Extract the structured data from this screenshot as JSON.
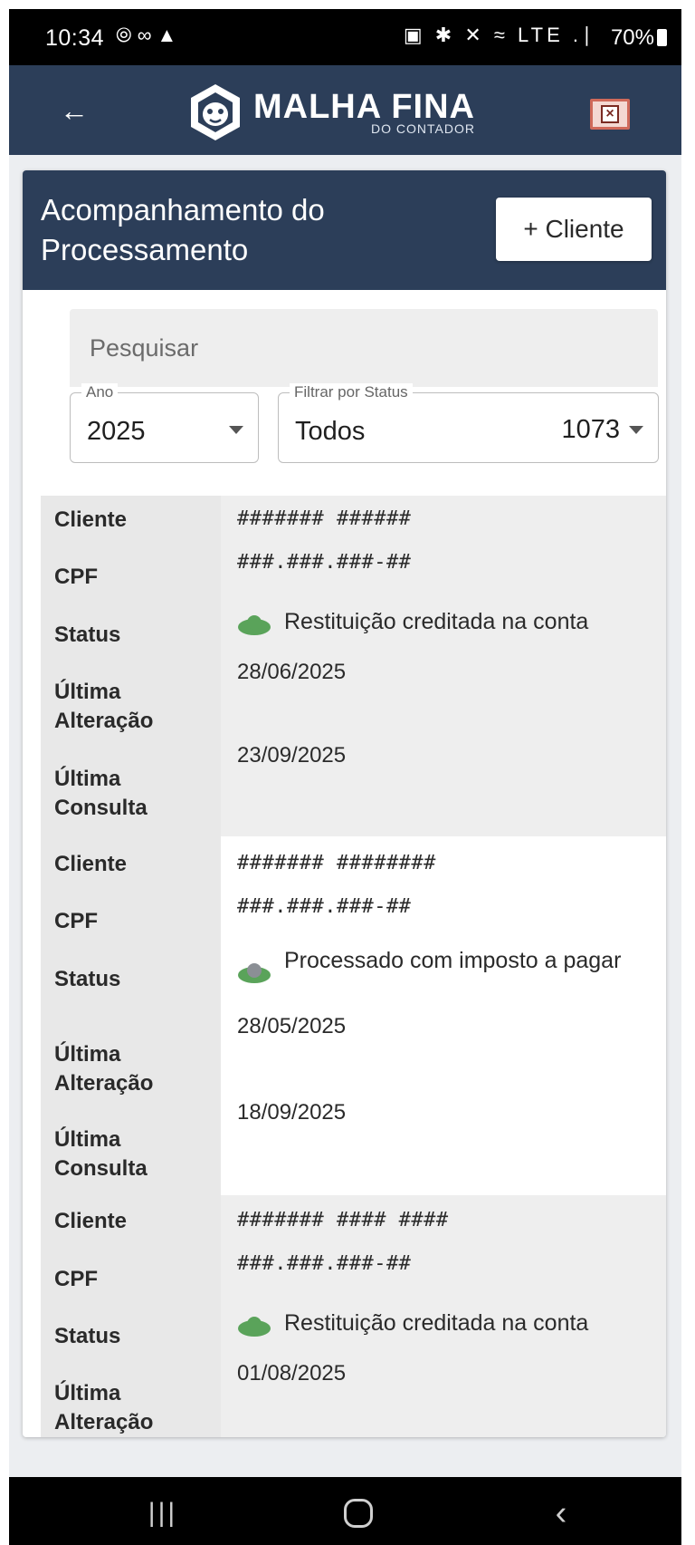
{
  "status_bar": {
    "time": "10:34",
    "left_icons": "⦾ ∞ ▲",
    "right_icons": "▣ ✱ ✕ ≈ LTE .∣",
    "battery": "70%"
  },
  "app_bar": {
    "logo_main": "MALHA FINA",
    "logo_sub": "DO CONTADOR"
  },
  "card": {
    "title": "Acompanhamento do Processamento",
    "add_button": "+ Cliente"
  },
  "search": {
    "placeholder": "Pesquisar"
  },
  "filters": {
    "year_label": "Ano",
    "year_value": "2025",
    "status_label": "Filtrar por Status",
    "status_value": "Todos",
    "status_count": "1073"
  },
  "labels": {
    "client": "Cliente",
    "cpf": "CPF",
    "status": "Status",
    "last_change_1": "Última",
    "last_change_2": "Alteração",
    "last_query_1": "Última",
    "last_query_2": "Consulta"
  },
  "records": [
    {
      "client": "####### ######",
      "cpf": "###.###.###-##",
      "status": "Restituição creditada na conta",
      "last_change": "28/06/2025",
      "last_query": "23/09/2025"
    },
    {
      "client": "####### ########",
      "cpf": "###.###.###-##",
      "status": "Processado com imposto a pagar",
      "last_change": "28/05/2025",
      "last_query": "18/09/2025"
    },
    {
      "client": "####### #### ####",
      "cpf": "###.###.###-##",
      "status": "Restituição creditada na conta",
      "last_change": "01/08/2025",
      "last_query": ""
    }
  ],
  "colors": {
    "header_navy": "#2c3e59",
    "cloud_green": "#5aa35a"
  }
}
